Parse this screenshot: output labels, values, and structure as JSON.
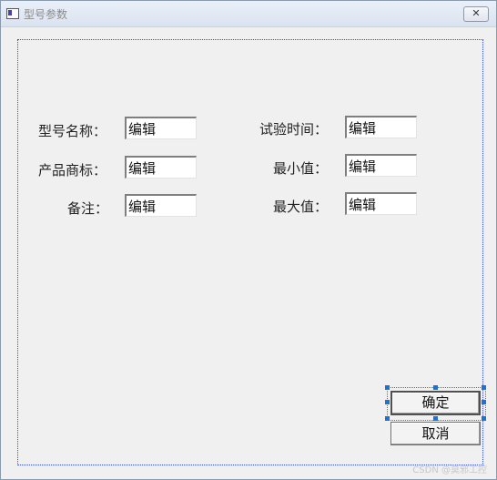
{
  "window": {
    "title": "型号参数",
    "close_label": "✕"
  },
  "form": {
    "model_name_label": "型号名称：",
    "model_name_value": "编辑",
    "product_mark_label": "产品商标：",
    "product_mark_value": "编辑",
    "remark_label": "备注：",
    "remark_value": "编辑",
    "test_time_label": "试验时间：",
    "test_time_value": "编辑",
    "min_label": "最小值：",
    "min_value": "编辑",
    "max_label": "最大值：",
    "max_value": "编辑"
  },
  "buttons": {
    "ok": "确定",
    "cancel": "取消"
  },
  "watermark": "CSDN @莫邪工控",
  "colors": {
    "selection": "#1f73d0",
    "client_border": "#3b4fd0"
  }
}
